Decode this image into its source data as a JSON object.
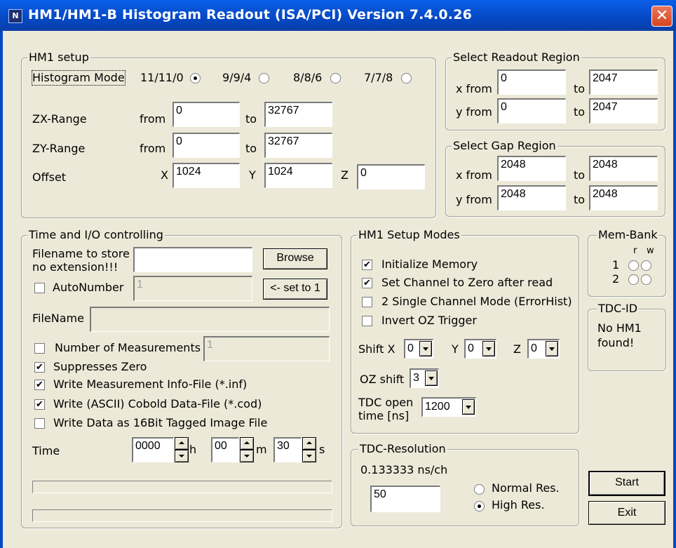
{
  "window": {
    "title": "HM1/HM1-B   Histogram Readout (ISA/PCI) Version 7.4.0.26",
    "app_icon": "app-logo-icon",
    "close": "✕"
  },
  "hm1_setup": {
    "legend": "HM1 setup",
    "histogram_mode_label": "Histogram Mode",
    "modes": [
      "11/11/0",
      "9/9/4",
      "8/8/6",
      "7/7/8"
    ],
    "selected_mode": "11/11/0",
    "zx_label": "ZX-Range",
    "zy_label": "ZY-Range",
    "offset_label": "Offset",
    "from_label": "from",
    "to_label": "to",
    "zx_from": "0",
    "zx_to": "32767",
    "zy_from": "0",
    "zy_to": "32767",
    "x_label": "X",
    "y_label": "Y",
    "z_label": "Z",
    "offset_x": "1024",
    "offset_y": "1024",
    "offset_z": "0"
  },
  "readout_region": {
    "legend": "Select Readout Region",
    "xfrom_label": "x from",
    "yfrom_label": "y from",
    "to_label": "to",
    "x_from": "0",
    "x_to": "2047",
    "y_from": "0",
    "y_to": "2047"
  },
  "gap_region": {
    "legend": "Select Gap Region",
    "xfrom_label": "x from",
    "yfrom_label": "y from",
    "to_label": "to",
    "x_from": "2048",
    "x_to": "2048",
    "y_from": "2048",
    "y_to": "2048"
  },
  "time_io": {
    "legend": "Time and I/O controlling",
    "filename_label_1": "Filename to store",
    "filename_label_2": "no extension!!!",
    "filename_value": "",
    "browse_label": "Browse",
    "autonumber_label": "AutoNumber",
    "autonumber_value": "1",
    "autonumber_checked": false,
    "set_to_1_label": "<- set to 1",
    "filename2_label": "FileName",
    "filename2_value": "",
    "num_meas_label": "Number of Measurements",
    "num_meas_value": "1",
    "num_meas_checked": false,
    "suppress_zero_label": "Suppresses Zero",
    "suppress_zero_checked": true,
    "write_info_label": "Write Measurement Info-File (*.inf)",
    "write_info_checked": true,
    "write_cobold_label": "Write (ASCII) Cobold Data-File (*.cod)",
    "write_cobold_checked": true,
    "write_tiff_label": "Write Data as 16Bit Tagged Image File",
    "write_tiff_checked": false,
    "time_label": "Time",
    "hours": "0000",
    "h_label": "h",
    "minutes": "00",
    "m_label": "m",
    "seconds": "30",
    "s_label": "s",
    "progress1": 0,
    "progress2": 0
  },
  "setup_modes": {
    "legend": "HM1 Setup Modes",
    "init_memory_label": "Initialize Memory",
    "init_memory_checked": true,
    "set_zero_label": "Set Channel to Zero after read",
    "set_zero_checked": true,
    "single_channel_label": "2 Single Channel Mode (ErrorHist)",
    "single_channel_checked": false,
    "invert_oz_label": "Invert OZ Trigger",
    "invert_oz_checked": false,
    "shift_x_label": "Shift X",
    "shift_x": "0",
    "shift_y_label": "Y",
    "shift_y": "0",
    "shift_z_label": "Z",
    "shift_z": "0",
    "oz_shift_label": "OZ shift",
    "oz_shift": "3",
    "tdc_open_label_1": "TDC open",
    "tdc_open_label_2": "time [ns]",
    "tdc_open": "1200"
  },
  "mem_bank": {
    "legend": "Mem-Bank",
    "r_label": "r",
    "w_label": "w",
    "row1": "1",
    "row2": "2"
  },
  "tdc_id": {
    "legend": "TDC-ID",
    "text_1": "No HM1",
    "text_2": "found!"
  },
  "tdc_resolution": {
    "legend": "TDC-Resolution",
    "value_text": "0.133333 ns/ch",
    "input_value": "50",
    "normal_label": "Normal Res.",
    "high_label": "High Res.",
    "selected": "High Res."
  },
  "buttons": {
    "start": "Start",
    "exit": "Exit"
  }
}
